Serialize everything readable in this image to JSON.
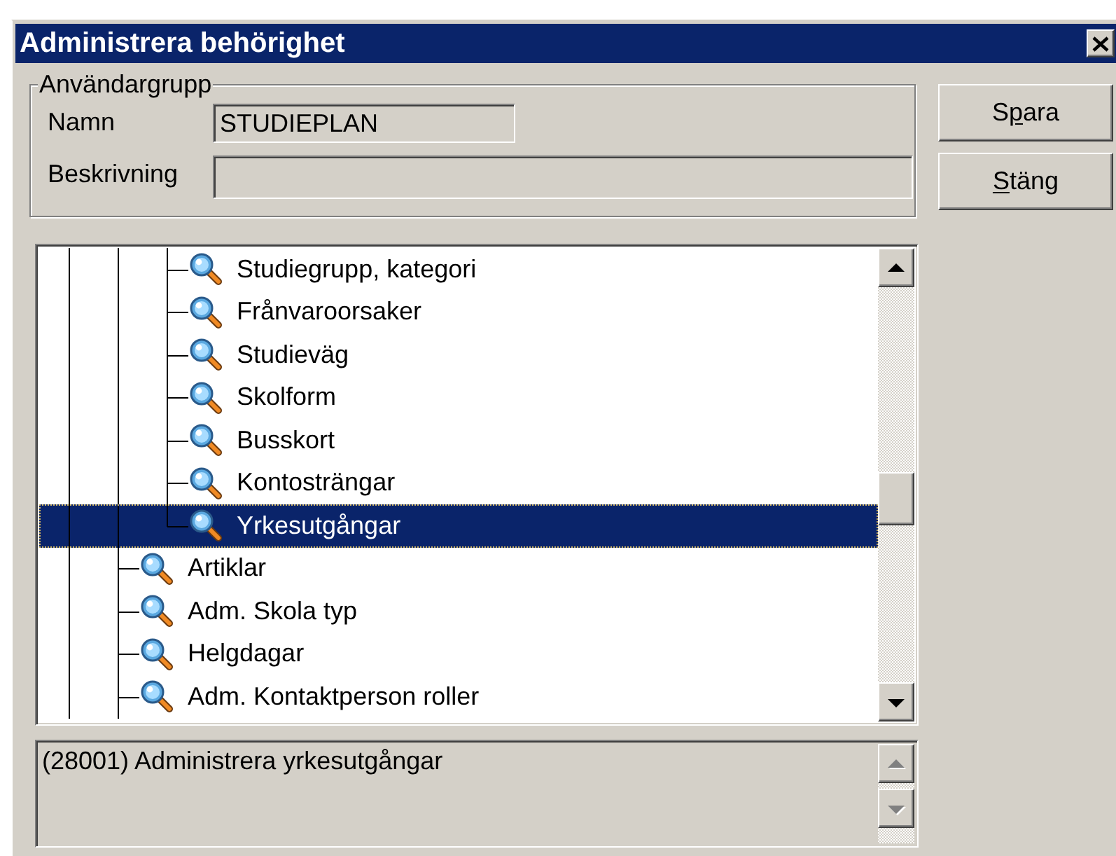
{
  "window": {
    "title": "Administrera behörighet"
  },
  "user_group": {
    "legend": "Användargrupp",
    "fields": [
      {
        "label": "Namn",
        "value": "STUDIEPLAN",
        "disabled": true,
        "kind": "short"
      },
      {
        "label": "Beskrivning",
        "disabled": true,
        "kind": "long"
      }
    ]
  },
  "buttons": [
    {
      "before": "S",
      "access_key": "p",
      "after": "ara"
    },
    {
      "access_key": "S",
      "after": "täng"
    }
  ],
  "tree": {
    "items": [
      {
        "children": [
          {
            "label": "Studiegrupp, kategori",
            "selected": false
          },
          {
            "label": "Frånvaroorsaker",
            "selected": false
          },
          {
            "label": "Studieväg",
            "selected": false
          },
          {
            "label": "Skolform",
            "selected": false
          },
          {
            "label": "Busskort",
            "selected": false
          },
          {
            "label": "Kontosträngar",
            "selected": false
          },
          {
            "label": "Yrkesutgångar",
            "selected": true
          }
        ]
      },
      {
        "label": "Artiklar",
        "selected": false
      },
      {
        "label": "Adm. Skola typ",
        "selected": false
      },
      {
        "label": "Helgdagar",
        "selected": false
      },
      {
        "label": "Adm. Kontaktperson roller",
        "selected": false
      }
    ]
  },
  "description": {
    "text": "(28001) Administrera yrkesutgångar",
    "scroll_disabled": true
  }
}
